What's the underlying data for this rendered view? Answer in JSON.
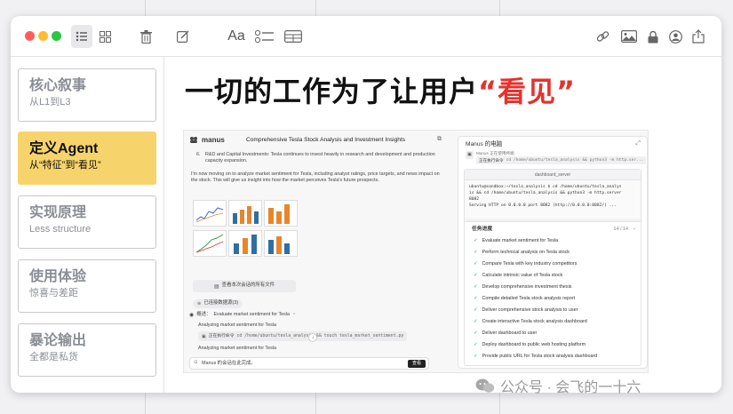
{
  "window": {
    "traffic_lights": [
      "#ff5f57",
      "#febc2e",
      "#28c840"
    ]
  },
  "sidebar": {
    "items": [
      {
        "title": "核心叙事",
        "subtitle": "从L1到L3"
      },
      {
        "title": "定义Agent",
        "subtitle": "从“特征”到“看见”"
      },
      {
        "title": "实现原理",
        "subtitle": "Less structure"
      },
      {
        "title": "使用体验",
        "subtitle": "惊喜与差距"
      },
      {
        "title": "暴论输出",
        "subtitle": "全都是私货"
      }
    ],
    "active_color": "#f7d46b"
  },
  "main": {
    "headline_black": "一切的工作为了让用户",
    "headline_red": "“看见”",
    "accent_red": "#e5322d"
  },
  "screenshot": {
    "logo": "manus",
    "doc_title": "Comprehensive Tesla Stock Analysis and Investment Insights",
    "item_num": "6.",
    "item_text": "R&D and Capital Investments: Tesla continues to invest heavily in research and development and production capacity expansion.",
    "para": "I'm now moving on to analyze market sentiment for Tesla, including analyst ratings, price targets, and news impact on the stock. This will give us insight into how the market perceives Tesla's future prospects.",
    "view_files": "查看本次会话的所有文件",
    "sources": "已连接数据源(3)",
    "step_label": "概述：",
    "step_title": "Evaluate market sentiment for Tesla",
    "analyzing1": "Analyzing market sentiment for Tesla",
    "exec_label": "正在执行命令",
    "exec_cmd": "cd /home/ubuntu/tesla_analysis && touch tesla_market_sentiment.py",
    "analyzing2": "Analyzing market sentiment for Tesla",
    "input_text": "Manus 的会话在此完成。",
    "input_btn": "查看",
    "computer_title": "Manus 的电脑",
    "computer_sub": "Manus 正在使用终端",
    "computer_cmd_label": "正在执行命令",
    "computer_cmd": "cd /home/ubuntu/tesla_analysis && python3 -m http.ser...",
    "server_tab": "dashboard_server",
    "terminal_lines": [
      "ubuntu@sandbox:~/tesla_analysis $ cd /home/ubuntu/tesla_analys",
      "is && cd /home/ubuntu/tesla_analysis && python3 -m http.server",
      "8082",
      "Serving HTTP on 0.0.0.0 port 8082 (http://0.0.0.0:8082/) ..."
    ],
    "progress_title": "任务进度",
    "progress_count": "14 / 14",
    "tasks": [
      "Evaluate market sentiment for Tesla",
      "Perform technical analysis on Tesla stock",
      "Compare Tesla with key industry competitors",
      "Calculate intrinsic value of Tesla stock",
      "Develop comprehensive investment thesis",
      "Compile detailed Tesla stock analysis report",
      "Deliver comprehensive stock analysis to user",
      "Create interactive Tesla stock analysis dashboard",
      "Deliver dashboard to user",
      "Deploy dashboard to public web hosting platform",
      "Provide public URL for Tesla stock analysis dashboard"
    ]
  },
  "watermark": "公众号 · 会飞的一十六"
}
